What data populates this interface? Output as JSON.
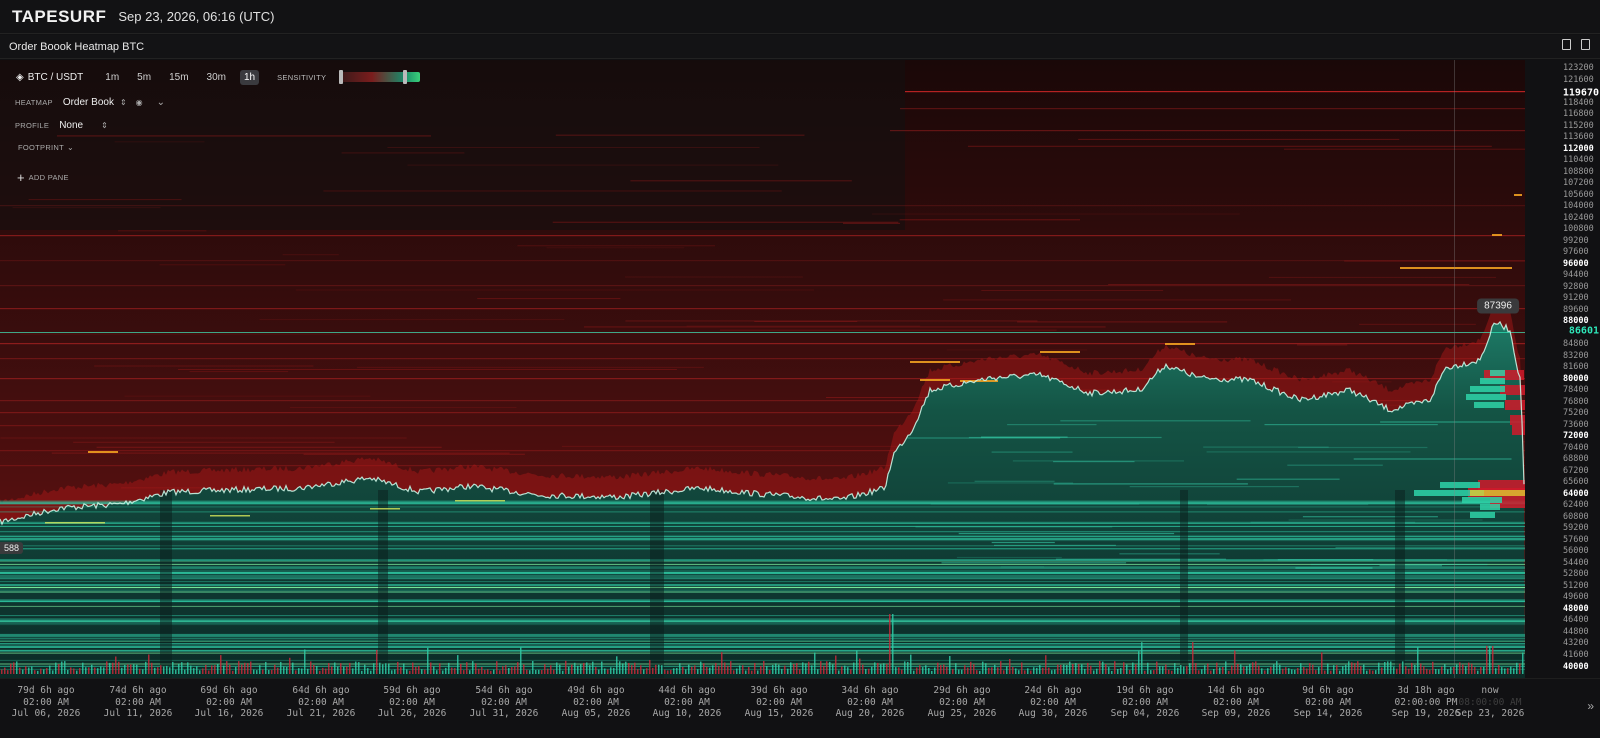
{
  "app": {
    "logo": "TAPESURF",
    "datetime": "Sep 23, 2026, 06:16 (UTC)",
    "window_title": "Order Boook Heatmap BTC"
  },
  "controls": {
    "pair": "BTC / USDT",
    "timeframes": [
      "1m",
      "5m",
      "15m",
      "30m",
      "1h"
    ],
    "active_timeframe": "1h",
    "sensitivity_label": "SENSITIVITY"
  },
  "panel": {
    "heatmap_label": "HEATMAP",
    "heatmap_value": "Order Book",
    "profile_label": "PROFILE",
    "profile_value": "None",
    "footprint_label": "FOOTPRINT",
    "add_pane_label": "ADD PANE"
  },
  "y_axis": {
    "ticks": [
      "123200",
      "121600",
      "118400",
      "116800",
      "115200",
      "113600",
      "112000",
      "110400",
      "108800",
      "107200",
      "105600",
      "104000",
      "102400",
      "100800",
      "99200",
      "97600",
      "96000",
      "94400",
      "92800",
      "91200",
      "89600",
      "88000",
      "84800",
      "83200",
      "81600",
      "80000",
      "78400",
      "76800",
      "75200",
      "73600",
      "72000",
      "70400",
      "68800",
      "67200",
      "65600",
      "64000",
      "62400",
      "60800",
      "59200",
      "57600",
      "56000",
      "54400",
      "52800",
      "51200",
      "49600",
      "48000",
      "46400",
      "44800",
      "43200",
      "41600",
      "40000"
    ],
    "highlighted": [
      "112000",
      "96000",
      "88000",
      "80000",
      "72000",
      "64000",
      "48000",
      "40000"
    ],
    "top_label": "119670",
    "current_price": "86601"
  },
  "labels": {
    "high_bubble": "87396",
    "low_bubble": "588"
  },
  "x_axis": {
    "ticks": [
      {
        "l1": "79d 6h ago",
        "l2": "02:00 AM",
        "l3": "Jul 06, 2026"
      },
      {
        "l1": "74d 6h ago",
        "l2": "02:00 AM",
        "l3": "Jul 11, 2026"
      },
      {
        "l1": "69d 6h ago",
        "l2": "02:00 AM",
        "l3": "Jul 16, 2026"
      },
      {
        "l1": "64d 6h ago",
        "l2": "02:00 AM",
        "l3": "Jul 21, 2026"
      },
      {
        "l1": "59d 6h ago",
        "l2": "02:00 AM",
        "l3": "Jul 26, 2026"
      },
      {
        "l1": "54d 6h ago",
        "l2": "02:00 AM",
        "l3": "Jul 31, 2026"
      },
      {
        "l1": "49d 6h ago",
        "l2": "02:00 AM",
        "l3": "Aug 05, 2026"
      },
      {
        "l1": "44d 6h ago",
        "l2": "02:00 AM",
        "l3": "Aug 10, 2026"
      },
      {
        "l1": "39d 6h ago",
        "l2": "02:00 AM",
        "l3": "Aug 15, 2026"
      },
      {
        "l1": "34d 6h ago",
        "l2": "02:00 AM",
        "l3": "Aug 20, 2026"
      },
      {
        "l1": "29d 6h ago",
        "l2": "02:00 AM",
        "l3": "Aug 25, 2026"
      },
      {
        "l1": "24d 6h ago",
        "l2": "02:00 AM",
        "l3": "Aug 30, 2026"
      },
      {
        "l1": "19d 6h ago",
        "l2": "02:00 AM",
        "l3": "Sep 04, 2026"
      },
      {
        "l1": "14d 6h ago",
        "l2": "02:00 AM",
        "l3": "Sep 09, 2026"
      },
      {
        "l1": "9d 6h ago",
        "l2": "02:00 AM",
        "l3": "Sep 14, 2026"
      },
      {
        "l1": "3d 18h ago",
        "l2": "02:00:00 PM",
        "l3": "Sep 19, 2026"
      },
      {
        "l1": "now",
        "l2": "08:00:00 AM",
        "l3": "Sep 23, 2026"
      }
    ]
  },
  "colors": {
    "background": "#111113",
    "ask_heat": "#8a1414",
    "bid_heat": "#1f9c84",
    "price_line": "#bfeee0",
    "current_price": "#2ee6b8"
  }
}
